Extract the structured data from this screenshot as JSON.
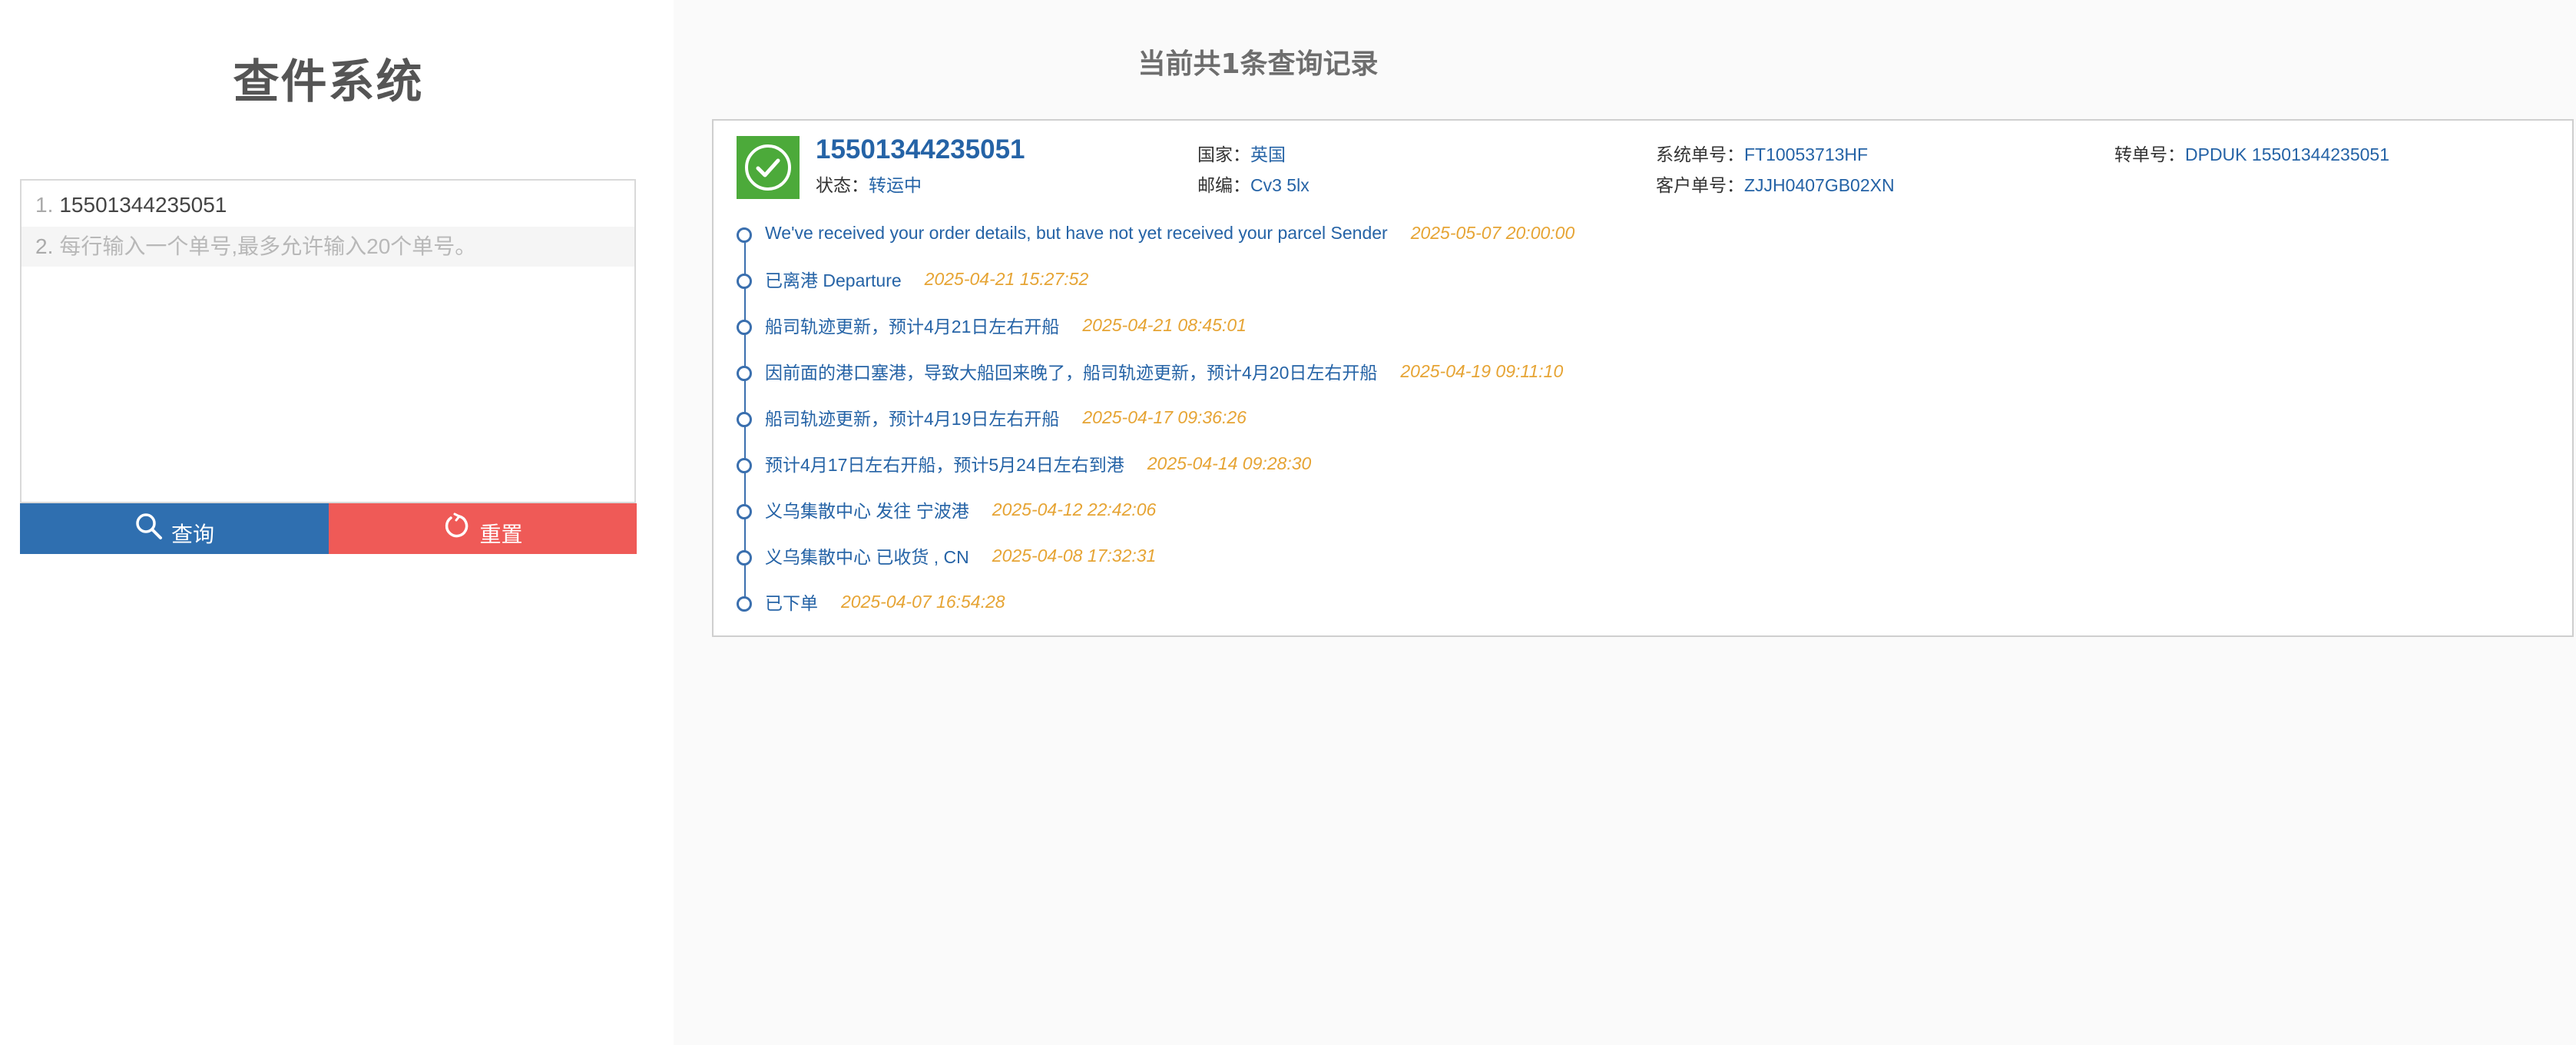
{
  "left": {
    "title": "查件系统",
    "input": {
      "line1_no": "1.",
      "line1_value": "15501344235051",
      "line2_no": "2.",
      "line2_placeholder": "每行输入一个单号,最多允许输入20个单号。"
    },
    "buttons": {
      "query_label": "查询",
      "reset_label": "重置"
    }
  },
  "results": {
    "heading": "当前共1条查询记录",
    "record": {
      "tracking_number": "15501344235051",
      "status_label": "状态：",
      "status_value": "转运中",
      "country_label": "国家：",
      "country_value": "英国",
      "postcode_label": "邮编：",
      "postcode_value": "Cv3 5lx",
      "system_no_label": "系统单号：",
      "system_no_value": "FT10053713HF",
      "customer_no_label": "客户单号：",
      "customer_no_value": "ZJJH0407GB02XN",
      "transfer_no_label": "转单号：",
      "transfer_no_value": "DPDUK 15501344235051",
      "events": [
        {
          "desc": "We've received your order details, but have not yet received your parcel Sender",
          "time": "2025-05-07 20:00:00"
        },
        {
          "desc": "已离港 Departure",
          "time": "2025-04-21 15:27:52"
        },
        {
          "desc": "船司轨迹更新，预计4月21日左右开船",
          "time": "2025-04-21 08:45:01"
        },
        {
          "desc": "因前面的港口塞港，导致大船回来晚了，船司轨迹更新，预计4月20日左右开船",
          "time": "2025-04-19 09:11:10"
        },
        {
          "desc": "船司轨迹更新，预计4月19日左右开船",
          "time": "2025-04-17 09:36:26"
        },
        {
          "desc": "预计4月17日左右开船，预计5月24日左右到港",
          "time": "2025-04-14 09:28:30"
        },
        {
          "desc": "义乌集散中心 发往 宁波港",
          "time": "2025-04-12 22:42:06"
        },
        {
          "desc": "义乌集散中心 已收货 , CN",
          "time": "2025-04-08 17:32:31"
        },
        {
          "desc": "已下单",
          "time": "2025-04-07 16:54:28"
        }
      ]
    }
  },
  "colors": {
    "primary_blue": "#2f6fb0",
    "reset_red": "#ef5a57",
    "status_green": "#4caa3a",
    "time_orange": "#e6a434",
    "link_blue": "#2563a6"
  },
  "icons": {
    "query": "search-icon",
    "reset": "refresh-icon",
    "status": "checkmark-circle-icon"
  }
}
